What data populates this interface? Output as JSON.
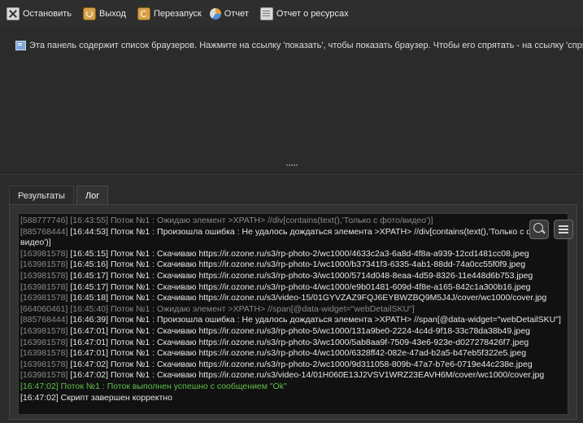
{
  "toolbar": {
    "stop_label": "Остановить",
    "exit_label": "Выход",
    "restart_label": "Перезапуск",
    "report_label": "Отчет",
    "resource_report_label": "Отчет о ресурсах"
  },
  "notice": {
    "text": "Эта панель содержит список браузеров. Нажмите на ссылку 'показать', чтобы показать браузер. Чтобы его спрятать - на ссылку 'спрятать'."
  },
  "tabs": [
    {
      "label": "Результаты"
    },
    {
      "label": "Лог"
    }
  ],
  "log": [
    {
      "id": "[588777746]",
      "time": "[16:43:55]",
      "msg": "Поток №1 : Ожидаю элемент >XPATH> //div[contains(text(),'Только с фото/видео')]",
      "style": "dim"
    },
    {
      "id": "[885768444]",
      "time": "[16:44:53]",
      "msg": "Поток №1 : Произошла ошибка : Не удалось дождаться элемента >XPATH> //div[contains(text(),'Только с фото/видео')]",
      "style": "norm"
    },
    {
      "id": "[163981578]",
      "time": "[16:45:15]",
      "msg": "Поток №1 : Скачиваю https://ir.ozone.ru/s3/rp-photo-2/wc1000/4633c2a3-6a8d-4f8a-a939-12cd1481cc08.jpeg",
      "style": "norm"
    },
    {
      "id": "[163981578]",
      "time": "[16:45:16]",
      "msg": "Поток №1 : Скачиваю https://ir.ozone.ru/s3/rp-photo-1/wc1000/b37341f3-6335-4ab1-88dd-74a0cc55f0f9.jpeg",
      "style": "norm"
    },
    {
      "id": "[163981578]",
      "time": "[16:45:17]",
      "msg": "Поток №1 : Скачиваю https://ir.ozone.ru/s3/rp-photo-3/wc1000/5714d048-8eaa-4d59-8326-11e448d6b753.jpeg",
      "style": "norm"
    },
    {
      "id": "[163981578]",
      "time": "[16:45:17]",
      "msg": "Поток №1 : Скачиваю https://ir.ozone.ru/s3/rp-photo-4/wc1000/e9b01481-609d-4f8e-a165-842c1a300b16.jpeg",
      "style": "norm"
    },
    {
      "id": "[163981578]",
      "time": "[16:45:18]",
      "msg": "Поток №1 : Скачиваю https://ir.ozone.ru/s3/video-15/01GYVZAZ9FQJ6EYBWZBQ9M5J4J/cover/wc1000/cover.jpg",
      "style": "norm"
    },
    {
      "id": "[664060461]",
      "time": "[16:45:40]",
      "msg": "Поток №1 : Ожидаю элемент >XPATH> //span[@data-widget=\"webDetailSKU\"]",
      "style": "dim"
    },
    {
      "id": "[885768444]",
      "time": "[16:46:39]",
      "msg": "Поток №1 : Произошла ошибка : Не удалось дождаться элемента >XPATH> //span[@data-widget=\"webDetailSKU\"]",
      "style": "norm"
    },
    {
      "id": "[163981578]",
      "time": "[16:47:01]",
      "msg": "Поток №1 : Скачиваю https://ir.ozone.ru/s3/rp-photo-5/wc1000/131a9be0-2224-4c4d-9f18-33c78da38b49.jpeg",
      "style": "norm"
    },
    {
      "id": "[163981578]",
      "time": "[16:47:01]",
      "msg": "Поток №1 : Скачиваю https://ir.ozone.ru/s3/rp-photo-3/wc1000/5ab8aa9f-7509-43e6-923e-d027278426f7.jpeg",
      "style": "norm"
    },
    {
      "id": "[163981578]",
      "time": "[16:47:01]",
      "msg": "Поток №1 : Скачиваю https://ir.ozone.ru/s3/rp-photo-4/wc1000/6328ff42-082e-47ad-b2a5-b47eb5f322e5.jpeg",
      "style": "norm"
    },
    {
      "id": "[163981578]",
      "time": "[16:47:02]",
      "msg": "Поток №1 : Скачиваю https://ir.ozone.ru/s3/rp-photo-2/wc1000/9d311058-809b-47a7-b7e6-0719e44c238e.jpeg",
      "style": "norm"
    },
    {
      "id": "[163981578]",
      "time": "[16:47:02]",
      "msg": "Поток №1 : Скачиваю https://ir.ozone.ru/s3/video-14/01H060E13J2VSV1WRZ23EAVH6M/cover/wc1000/cover.jpg",
      "style": "norm"
    },
    {
      "id": "",
      "time": "[16:47:02]",
      "msg": "Поток №1 : Поток выполнен успешно с сообщением \"Ok\"",
      "style": "ok"
    },
    {
      "id": "",
      "time": "[16:47:02]",
      "msg": "Скрипт завершен корректно",
      "style": "norm"
    }
  ],
  "icons": {
    "stop": "close-box-icon",
    "exit": "power-icon",
    "restart": "restart-icon",
    "report": "pie-chart-icon",
    "resource_report": "document-icon",
    "notice": "info-icon",
    "search": "search-icon",
    "menu": "menu-icon"
  },
  "colors": {
    "background": "#2b2b2b",
    "log_background": "#111111",
    "dim_text": "#8a8a8a",
    "normal_text": "#e6e6e6",
    "success_text": "#5fbf4a"
  }
}
